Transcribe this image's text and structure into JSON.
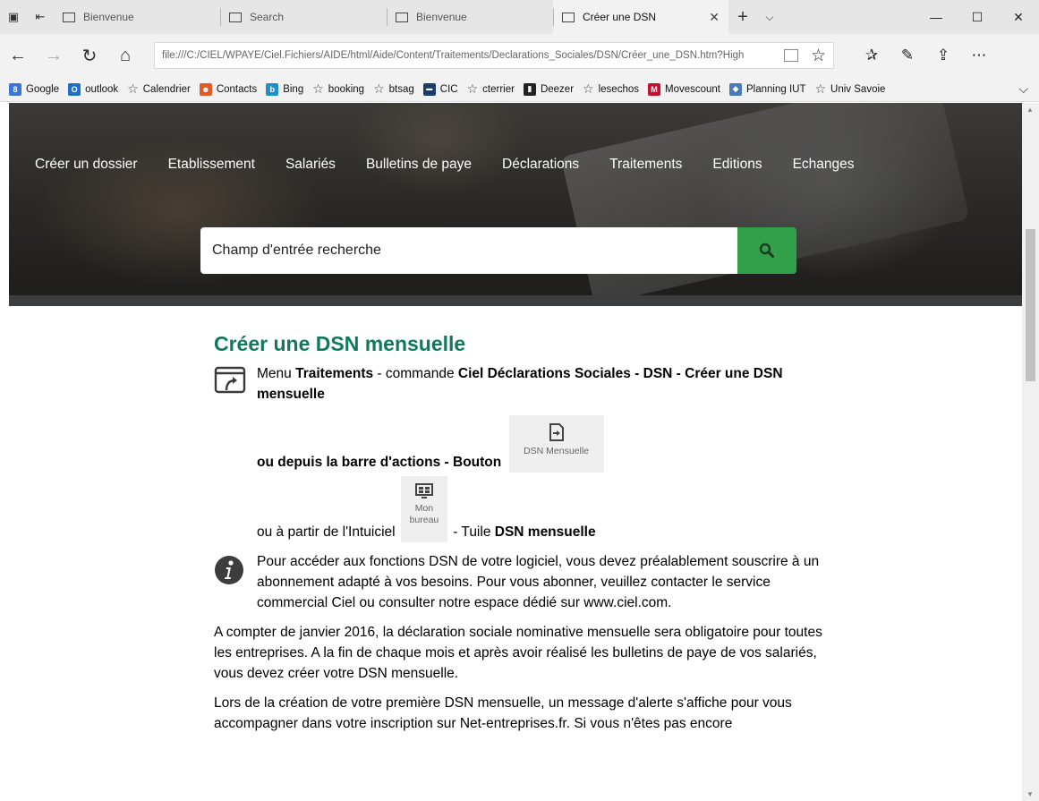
{
  "browser": {
    "tabs": [
      {
        "title": "Bienvenue",
        "active": false
      },
      {
        "title": "Search",
        "active": false
      },
      {
        "title": "Bienvenue",
        "active": false
      },
      {
        "title": "Créer une DSN",
        "active": true
      }
    ],
    "address": "file:///C:/CIEL/WPAYE/Ciel.Fichiers/AIDE/html/Aide/Content/Traitements/Declarations_Sociales/DSN/Créer_une_DSN.htm?High",
    "favorites": [
      "Google",
      "outlook",
      "Calendrier",
      "Contacts",
      "Bing",
      "booking",
      "btsag",
      "CIC",
      "cterrier",
      "Deezer",
      "lesechos",
      "Movescount",
      "Planning IUT",
      "Univ Savoie"
    ]
  },
  "page": {
    "menu": [
      "Créer un dossier",
      "Etablissement",
      "Salariés",
      "Bulletins de paye",
      "Déclarations",
      "Traitements",
      "Editions",
      "Echanges"
    ],
    "search": {
      "placeholder": "Champ d'entrée recherche"
    },
    "title": "Créer une DSN mensuelle",
    "nav_instructions": {
      "line1_pre": "Menu ",
      "line1_b1": "Traitements",
      "line1_mid": " - commande ",
      "line1_b2": "Ciel Déclarations Sociales - DSN - Créer une DSN mensuelle",
      "line2": "ou depuis la barre d'actions - Bouton",
      "dsn_button": "DSN Mensuelle",
      "line3_pre": "ou à partir de l'Intuiciel",
      "mon_bureau": "Mon bureau",
      "line3_mid": " - Tuile ",
      "line3_b": "DSN mensuelle"
    },
    "info": "Pour accéder aux fonctions DSN de votre logiciel, vous devez préalablement souscrire à un abonnement adapté à vos besoins. Pour vous abonner, veuillez contacter le service commercial Ciel ou consulter notre espace dédié sur www.ciel.com.",
    "para1": "A compter de janvier 2016, la déclaration sociale nominative mensuelle sera obligatoire pour toutes les entreprises. A la fin de chaque mois et après avoir réalisé les bulletins de paye de vos salariés, vous devez créer votre DSN mensuelle.",
    "para2": "Lors de la création de votre première DSN mensuelle, un message d'alerte s'affiche pour vous accompagner dans votre inscription sur Net-entreprises.fr. Si vous n'êtes pas encore"
  }
}
